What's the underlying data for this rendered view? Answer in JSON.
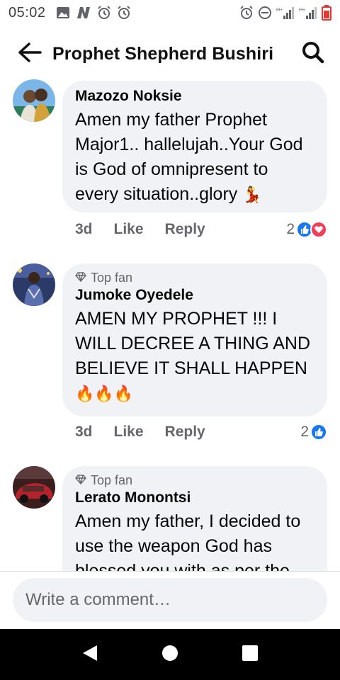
{
  "status_bar": {
    "time": "05:02",
    "left_icons": [
      "gallery-icon",
      "n-app-icon",
      "alarm-icon",
      "alarm-icon"
    ],
    "right_icons": [
      "alarm-icon",
      "dnd-icon",
      "signal-h-plus-icon",
      "signal-h-plus-icon",
      "battery-low-icon"
    ],
    "battery_color": "#e53935"
  },
  "header": {
    "title": "Prophet Shepherd Bushiri"
  },
  "comments": [
    {
      "top_fan": false,
      "author": "Mazozo Noksie",
      "text": "Amen my father Prophet Major1.. hallelujah..Your God is God of omnipresent to every situation..glory",
      "emoji": "💃",
      "age": "3d",
      "like_label": "Like",
      "reply_label": "Reply",
      "reaction_count": "2",
      "reactions": [
        "like-reaction-icon",
        "love-reaction-icon"
      ]
    },
    {
      "top_fan": true,
      "badge": "Top fan",
      "author": "Jumoke Oyedele",
      "text": "AMEN MY PROPHET !!!  I WILL DECREE A THING AND BELIEVE IT SHALL HAPPEN",
      "emoji": "🔥🔥🔥",
      "age": "3d",
      "like_label": "Like",
      "reply_label": "Reply",
      "reaction_count": "2",
      "reactions": [
        "like-reaction-icon"
      ]
    },
    {
      "top_fan": true,
      "badge": "Top fan",
      "author": "Lerato Monontsi",
      "text": "Amen my father, I decided to use the weapon God has blessed you with as per the"
    }
  ],
  "composer": {
    "placeholder": "Write a comment…"
  },
  "colors": {
    "like_blue": "#1877f2",
    "love_red": "#f33e58",
    "bubble_bg": "#f0f2f5",
    "secondary_text": "#65676b"
  }
}
